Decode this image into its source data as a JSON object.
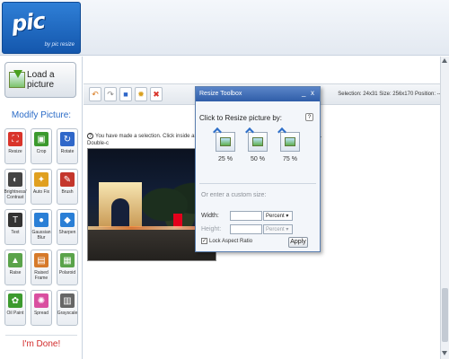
{
  "header": {
    "logo_text": "pic",
    "logo_sub": "by pic resize"
  },
  "left_panel": {
    "load_label": "Load a picture",
    "modify_title": "Modify Picture:",
    "tools": [
      {
        "label": "Resize",
        "icon": "resize-icon",
        "color": "#d9342a"
      },
      {
        "label": "Crop",
        "icon": "crop-icon",
        "color": "#3c9a2e"
      },
      {
        "label": "Rotate",
        "icon": "rotate-icon",
        "color": "#2f67c9"
      },
      {
        "label": "Brightness/ Contrast",
        "icon": "brightness-icon",
        "color": "#444444"
      },
      {
        "label": "Auto Fix",
        "icon": "magic-wand-icon",
        "color": "#e0a020"
      },
      {
        "label": "Brush",
        "icon": "brush-icon",
        "color": "#c4362b"
      },
      {
        "label": "Text",
        "icon": "text-icon",
        "color": "#333333"
      },
      {
        "label": "Gaussian Blur",
        "icon": "blur-icon",
        "color": "#2a7fd6"
      },
      {
        "label": "Sharpen",
        "icon": "sharpen-icon",
        "color": "#2a7fd6"
      },
      {
        "label": "Raise",
        "icon": "raise-icon",
        "color": "#5aa34a"
      },
      {
        "label": "Raised Frame",
        "icon": "raised-frame-icon",
        "color": "#d67a2a"
      },
      {
        "label": "Polaroid",
        "icon": "polaroid-icon",
        "color": "#5aa34a"
      },
      {
        "label": "Oil Paint",
        "icon": "oil-paint-icon",
        "color": "#3c9a2e"
      },
      {
        "label": "Spread",
        "icon": "spread-icon",
        "color": "#d94fa0"
      },
      {
        "label": "Grayscale",
        "icon": "grayscale-icon",
        "color": "#666666"
      }
    ],
    "done_label": "I'm Done!"
  },
  "toolbar": {
    "status": "Selection: 24x31 Size: 256x170 Position: -- ,"
  },
  "canvas": {
    "info_text": "You have made a selection. Click inside and drag to move the selection to contrain to a square. Double-c",
    "info_tail": "g"
  },
  "dialog": {
    "title": "Resize Toolbox",
    "minimize": "_",
    "close": "x",
    "heading": "Click to Resize picture by:",
    "help": "?",
    "presets": [
      "25 %",
      "50 %",
      "75 %"
    ],
    "custom_heading": "Or enter a custom size:",
    "width_label": "Width:",
    "height_label": "Height:",
    "width_value": "",
    "height_value": "",
    "width_unit": "Percent",
    "height_unit": "Percent",
    "lock_label": "Lock Aspect Ratio",
    "lock_checked": "✓",
    "apply_label": "Apply"
  }
}
